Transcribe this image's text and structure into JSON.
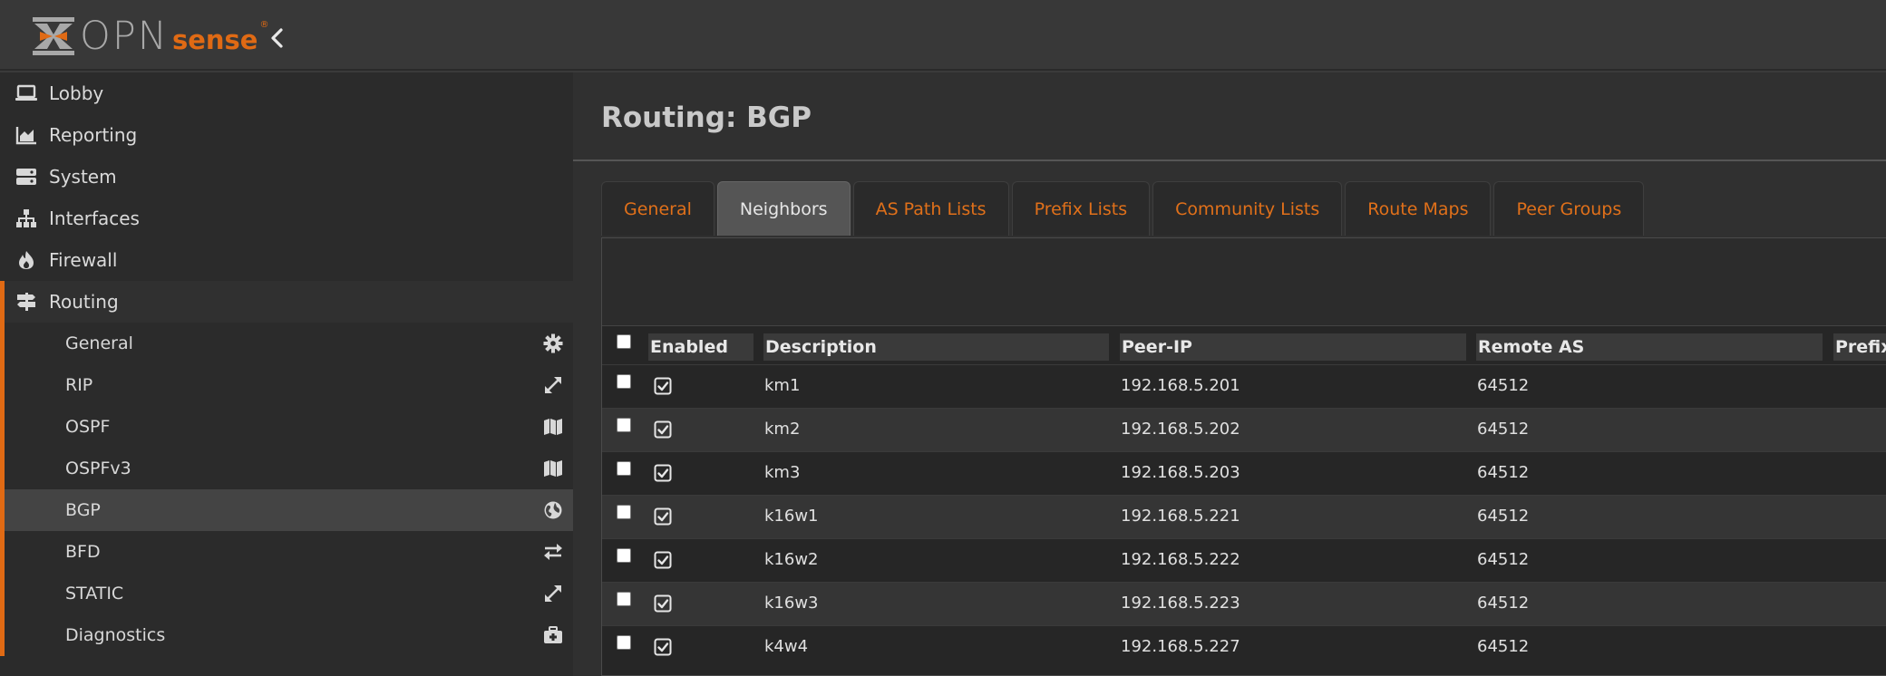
{
  "app": {
    "brand_open": "OPN",
    "brand_sense": "sense",
    "brand_reg": "®"
  },
  "colors": {
    "accent": "#e06a14",
    "bg_dark": "#2b2b2b",
    "tab_text": "#e0701a"
  },
  "sidebar": {
    "top_items": [
      {
        "label": "Lobby",
        "icon": "laptop-icon"
      },
      {
        "label": "Reporting",
        "icon": "area-chart-icon"
      },
      {
        "label": "System",
        "icon": "server-icon"
      },
      {
        "label": "Interfaces",
        "icon": "sitemap-icon"
      },
      {
        "label": "Firewall",
        "icon": "fire-icon"
      },
      {
        "label": "Routing",
        "icon": "signpost-icon"
      }
    ],
    "routing_items": [
      {
        "label": "General",
        "icon": "gear-icon"
      },
      {
        "label": "RIP",
        "icon": "expand-arrows-icon"
      },
      {
        "label": "OSPF",
        "icon": "map-icon"
      },
      {
        "label": "OSPFv3",
        "icon": "map-icon"
      },
      {
        "label": "BGP",
        "icon": "globe-icon"
      },
      {
        "label": "BFD",
        "icon": "exchange-icon"
      },
      {
        "label": "STATIC",
        "icon": "expand-arrows-icon"
      },
      {
        "label": "Diagnostics",
        "icon": "medkit-icon"
      }
    ]
  },
  "main": {
    "title": "Routing: BGP",
    "tabs": [
      "General",
      "Neighbors",
      "AS Path Lists",
      "Prefix Lists",
      "Community Lists",
      "Route Maps",
      "Peer Groups"
    ],
    "active_tab": "Neighbors",
    "grid": {
      "columns": [
        "Enabled",
        "Description",
        "Peer-IP",
        "Remote AS",
        "Prefix-"
      ],
      "rows": [
        {
          "enabled": true,
          "description": "km1",
          "peer_ip": "192.168.5.201",
          "remote_as": "64512"
        },
        {
          "enabled": true,
          "description": "km2",
          "peer_ip": "192.168.5.202",
          "remote_as": "64512"
        },
        {
          "enabled": true,
          "description": "km3",
          "peer_ip": "192.168.5.203",
          "remote_as": "64512"
        },
        {
          "enabled": true,
          "description": "k16w1",
          "peer_ip": "192.168.5.221",
          "remote_as": "64512"
        },
        {
          "enabled": true,
          "description": "k16w2",
          "peer_ip": "192.168.5.222",
          "remote_as": "64512"
        },
        {
          "enabled": true,
          "description": "k16w3",
          "peer_ip": "192.168.5.223",
          "remote_as": "64512"
        },
        {
          "enabled": true,
          "description": "k4w4",
          "peer_ip": "192.168.5.227",
          "remote_as": "64512"
        }
      ]
    }
  }
}
